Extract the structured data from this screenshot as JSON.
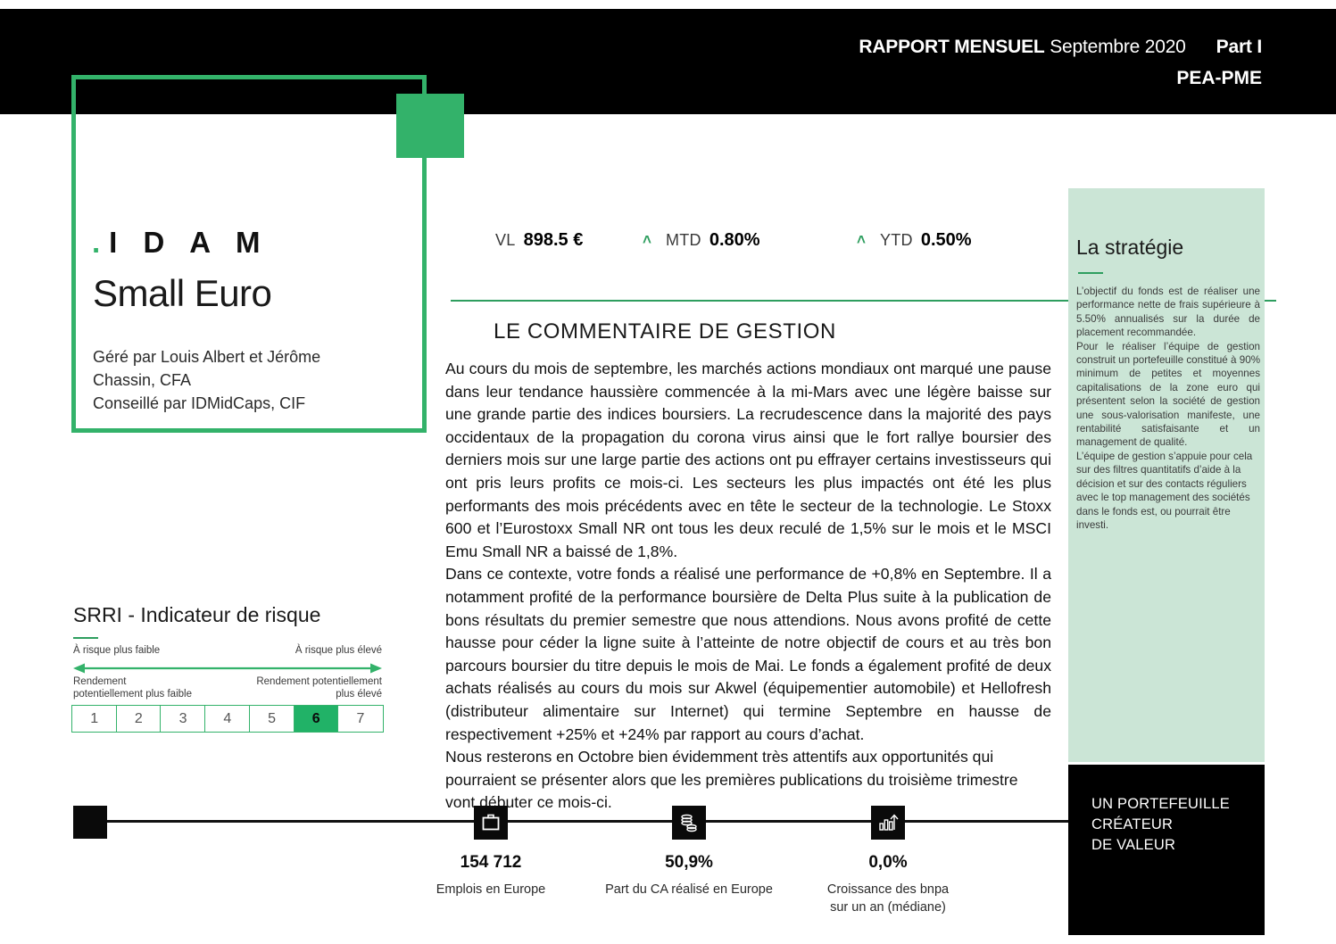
{
  "header": {
    "report_label": "RAPPORT MENSUEL",
    "period": "Septembre 2020",
    "part": "Part I",
    "scheme": "PEA-PME"
  },
  "brand": {
    "dot": ".",
    "name": "I D A M",
    "fund_name": "Small Euro",
    "managers_line1": "Géré par Louis Albert et Jérôme",
    "managers_line2": "Chassin, CFA",
    "managers_line3": "Conseillé par IDMidCaps, CIF"
  },
  "metrics": {
    "vl_label": "VL",
    "vl_value": "898.5 €",
    "mtd_label": "MTD",
    "mtd_value": "0.80%",
    "mtd_caret": "˄",
    "ytd_label": "YTD",
    "ytd_value": "0.50%",
    "ytd_caret": "˄"
  },
  "commentary": {
    "title": "LE COMMENTAIRE DE GESTION",
    "paragraph_1": "Au cours du mois de septembre, les marchés actions mondiaux ont marqué une pause dans leur tendance haussière commencée à la mi-Mars avec une légère baisse sur une grande partie des indices boursiers. La recrudescence dans la majorité des pays occidentaux de la propagation du corona virus ainsi que le fort rallye boursier des derniers mois sur une large partie des actions ont pu effrayer certains investisseurs qui ont pris leurs profits ce mois-ci. Les secteurs les plus impactés ont été les plus performants des mois précédents avec en tête le secteur de la technologie. Le Stoxx 600 et l’Eurostoxx Small NR ont tous les deux reculé de 1,5% sur le mois et le MSCI Emu Small NR a baissé de 1,8%.",
    "paragraph_2": "Dans ce contexte, votre fonds a réalisé une performance de +0,8% en Septembre. Il a notamment profité de la performance boursière de Delta Plus suite à la publication de bons résultats du premier semestre que nous attendions. Nous avons profité de cette hausse pour céder la ligne suite à l’atteinte de notre objectif de cours et au très bon parcours boursier du titre depuis le mois de Mai. Le fonds a également profité de deux achats réalisés au cours du mois sur Akwel (équipementier automobile) et Hellofresh (distributeur alimentaire sur Internet) qui termine Septembre en hausse de respectivement +25% et +24% par rapport au cours d’achat.",
    "paragraph_3": "Nous resterons en Octobre bien évidemment très attentifs aux opportunités qui pourraient se présenter alors que les premières publications du troisième trimestre vont débuter ce mois-ci."
  },
  "strategy": {
    "title": "La stratégie",
    "paragraph_1": "L’objectif du fonds est de réaliser une performance nette de frais supérieure à 5.50% annualisés sur la durée de placement recommandée.",
    "paragraph_2": "Pour le réaliser l’équipe de gestion construit un portefeuille constitué à 90% minimum de petites et moyennes capitalisations de la zone euro qui présentent selon la société de gestion une sous-valorisation manifeste, une rentabilité satisfaisante et un management de qualité.",
    "paragraph_3": "L’équipe de gestion s’appuie pour cela sur des filtres quantitatifs d’aide à la décision et sur des contacts réguliers avec le top management des sociétés dans le fonds est, ou pourrait être investi."
  },
  "tagline": {
    "line1": "UN PORTEFEUILLE",
    "line2": "CRÉATEUR",
    "line3": "DE VALEUR"
  },
  "srri": {
    "title": "SRRI - Indicateur de risque",
    "label_low_risk": "À risque plus faible",
    "label_high_risk": "À risque plus élevé",
    "return_low": "Rendement\npotentiellement plus faible",
    "return_low_l1": "Rendement",
    "return_low_l2": "potentiellement plus faible",
    "return_high_l1": "Rendement  potentiellement",
    "return_high_l2": "plus élevé",
    "scale": [
      "1",
      "2",
      "3",
      "4",
      "5",
      "6",
      "7"
    ],
    "active_value": "6"
  },
  "stats": [
    {
      "icon": "briefcase-icon",
      "value": "154 712",
      "label_line1": "Emplois en Europe",
      "label_line2": ""
    },
    {
      "icon": "coins-icon",
      "value": "50,9%",
      "label_line1": "Part du CA réalisé en Europe",
      "label_line2": ""
    },
    {
      "icon": "bar-chart-icon",
      "value": "0,0%",
      "label_line1": "Croissance des bnpa",
      "label_line2": "sur un an (médiane)"
    }
  ],
  "colors": {
    "accent_green": "#33b26a",
    "rule_green": "#2e9e5f",
    "panel_green": "#cbe5d6",
    "black": "#000000"
  }
}
